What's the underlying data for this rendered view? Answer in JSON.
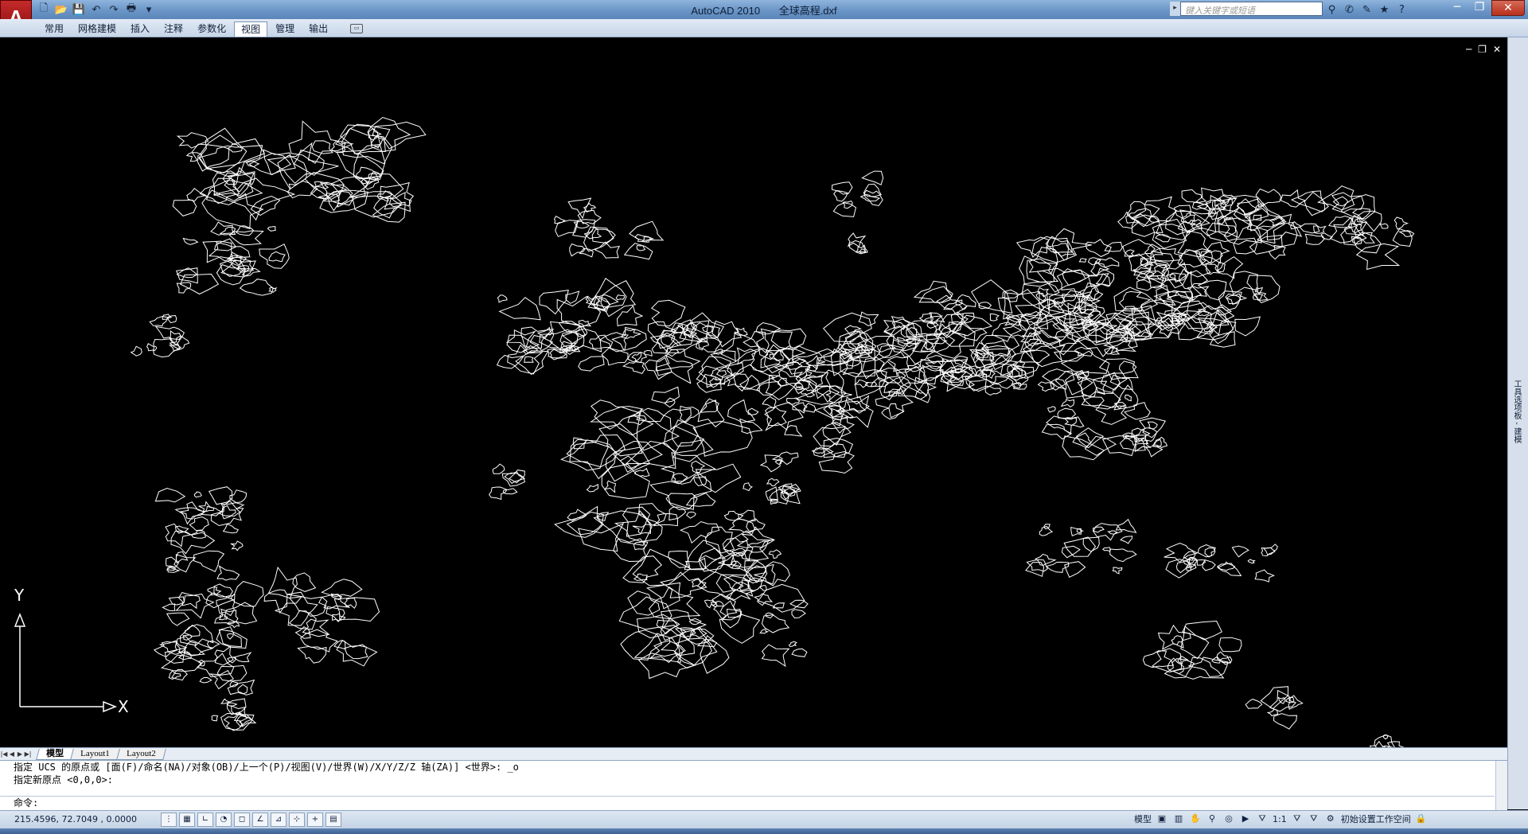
{
  "window": {
    "app_name": "AutoCAD 2010",
    "file_name": "全球高程.dxf",
    "minimize": "─",
    "restore": "❐",
    "close": "✕"
  },
  "app_button": "A",
  "qat": [
    {
      "name": "new-icon",
      "glyph": "🗋"
    },
    {
      "name": "open-icon",
      "glyph": "📂"
    },
    {
      "name": "save-icon",
      "glyph": "💾"
    },
    {
      "name": "undo-icon",
      "glyph": "↶"
    },
    {
      "name": "redo-icon",
      "glyph": "↷"
    },
    {
      "name": "print-icon",
      "glyph": "🖶"
    },
    {
      "name": "qat-dropdown-icon",
      "glyph": "▾"
    }
  ],
  "search": {
    "placeholder": "键入关键字或短语"
  },
  "info_tools": [
    {
      "name": "binoculars-icon",
      "glyph": "⚲"
    },
    {
      "name": "communication-center-icon",
      "glyph": "✆"
    },
    {
      "name": "tools-icon",
      "glyph": "✎"
    },
    {
      "name": "star-icon",
      "glyph": "★"
    },
    {
      "name": "help-icon",
      "glyph": "?"
    }
  ],
  "ribbon_tabs": [
    "常用",
    "网格建模",
    "插入",
    "注释",
    "参数化",
    "视图",
    "管理",
    "输出"
  ],
  "active_tab": "视图",
  "doc_controls": {
    "minimize": "─",
    "restore": "❐",
    "close": "✕"
  },
  "ucs": {
    "x_label": "X",
    "y_label": "Y"
  },
  "palette_label": "工具选项板 - 建模",
  "layout_tabs": [
    "模型",
    "Layout1",
    "Layout2"
  ],
  "active_layout": "模型",
  "command": {
    "history": [
      "指定 UCS 的原点或 [面(F)/命名(NA)/对象(OB)/上一个(P)/视图(V)/世界(W)/X/Y/Z/Z 轴(ZA)] <世界>: _o",
      "指定新原点 <0,0,0>:"
    ],
    "prompt": "命令:"
  },
  "status": {
    "coordinates": "215.4596,  72.7049 , 0.0000",
    "model_label": "模型",
    "annotation_scale": "1:1",
    "workspace": "初始设置工作空间"
  },
  "colors": {
    "drawing_background": "#000000",
    "contour_color": "#ffffff",
    "title_bar": "#6a95c6",
    "app_button": "#b01c1c"
  }
}
